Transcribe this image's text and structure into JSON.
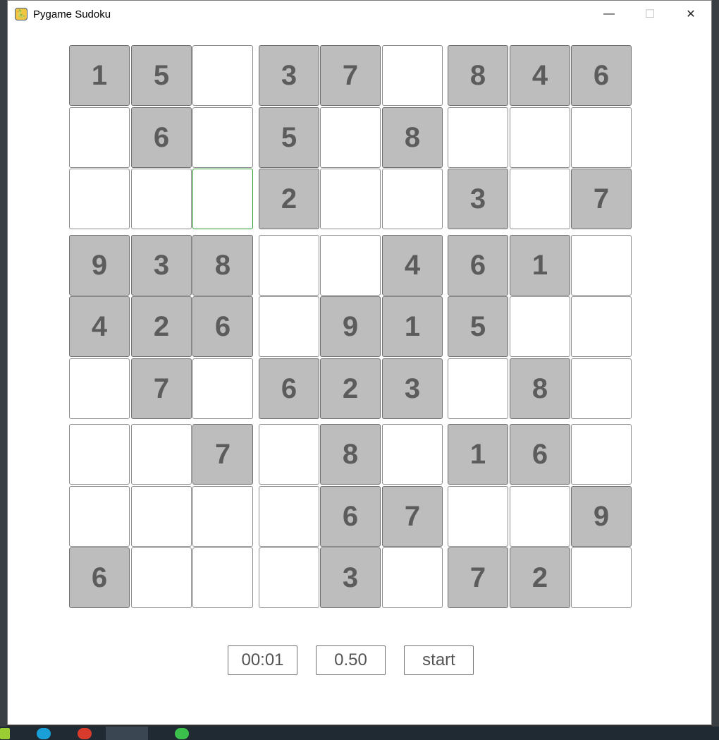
{
  "window": {
    "title": "Pygame Sudoku",
    "controls": {
      "minimize": "—",
      "maximize": "☐",
      "close": "✕"
    }
  },
  "board": {
    "grid": [
      [
        "1",
        "5",
        "",
        "3",
        "7",
        "",
        "8",
        "4",
        "6"
      ],
      [
        "",
        "6",
        "",
        "5",
        "",
        "8",
        "",
        "",
        ""
      ],
      [
        "",
        "",
        "",
        "2",
        "",
        "",
        "3",
        "",
        "7"
      ],
      [
        "9",
        "3",
        "8",
        "",
        "",
        "4",
        "6",
        "1",
        ""
      ],
      [
        "4",
        "2",
        "6",
        "",
        "9",
        "1",
        "5",
        "",
        ""
      ],
      [
        "",
        "7",
        "",
        "6",
        "2",
        "3",
        "",
        "8",
        ""
      ],
      [
        "",
        "",
        "7",
        "",
        "8",
        "",
        "1",
        "6",
        ""
      ],
      [
        "",
        "",
        "",
        "",
        "6",
        "7",
        "",
        "",
        "9"
      ],
      [
        "6",
        "",
        "",
        "",
        "3",
        "",
        "7",
        "2",
        ""
      ]
    ],
    "selected": {
      "row": 2,
      "col": 2
    }
  },
  "controls": {
    "timer": "00:01",
    "difficulty": "0.50",
    "start_label": "start"
  },
  "colors": {
    "given_cell": "#bdbdbd",
    "selected_border": "#2e9b2e",
    "digit": "#5c5c5c"
  }
}
